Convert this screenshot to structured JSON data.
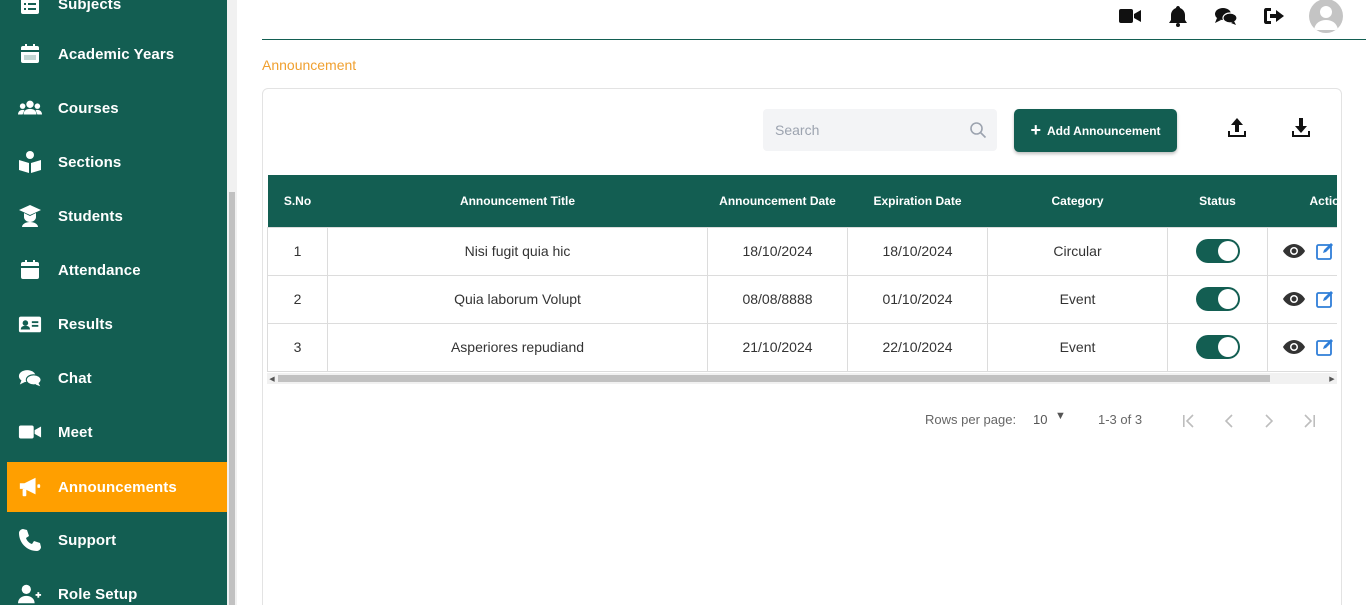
{
  "sidebar": {
    "items": [
      {
        "label": "Subjects",
        "icon": "list-icon"
      },
      {
        "label": "Academic Years",
        "icon": "calendar-icon"
      },
      {
        "label": "Courses",
        "icon": "users-icon"
      },
      {
        "label": "Sections",
        "icon": "reader-icon"
      },
      {
        "label": "Students",
        "icon": "student-icon"
      },
      {
        "label": "Attendance",
        "icon": "calendar-icon"
      },
      {
        "label": "Results",
        "icon": "id-card-icon"
      },
      {
        "label": "Chat",
        "icon": "chat-icon"
      },
      {
        "label": "Meet",
        "icon": "video-icon"
      },
      {
        "label": "Announcements",
        "icon": "megaphone-icon",
        "active": true
      },
      {
        "label": "Support",
        "icon": "phone-icon"
      },
      {
        "label": "Role Setup",
        "icon": "user-plus-icon"
      }
    ]
  },
  "breadcrumb": "Announcement",
  "search": {
    "placeholder": "Search",
    "value": ""
  },
  "toolbar": {
    "add_label": "Add Announcement"
  },
  "table": {
    "columns": [
      "S.No",
      "Announcement Title",
      "Announcement Date",
      "Expiration Date",
      "Category",
      "Status",
      "Action"
    ],
    "rows": [
      {
        "sno": "1",
        "title": "Nisi fugit quia hic",
        "date": "18/10/2024",
        "expiry": "18/10/2024",
        "category": "Circular",
        "status": true
      },
      {
        "sno": "2",
        "title": "Quia laborum Volupt",
        "date": "08/08/8888",
        "expiry": "01/10/2024",
        "category": "Event",
        "status": true
      },
      {
        "sno": "3",
        "title": "Asperiores repudiand",
        "date": "21/10/2024",
        "expiry": "22/10/2024",
        "category": "Event",
        "status": true
      }
    ]
  },
  "pagination": {
    "rows_label": "Rows per page:",
    "rows_value": "10",
    "range": "1-3 of 3"
  },
  "colors": {
    "primary": "#135e52",
    "accent": "#ff9f00",
    "breadcrumb": "#f0a030",
    "action_blue": "#2f7ed8"
  }
}
